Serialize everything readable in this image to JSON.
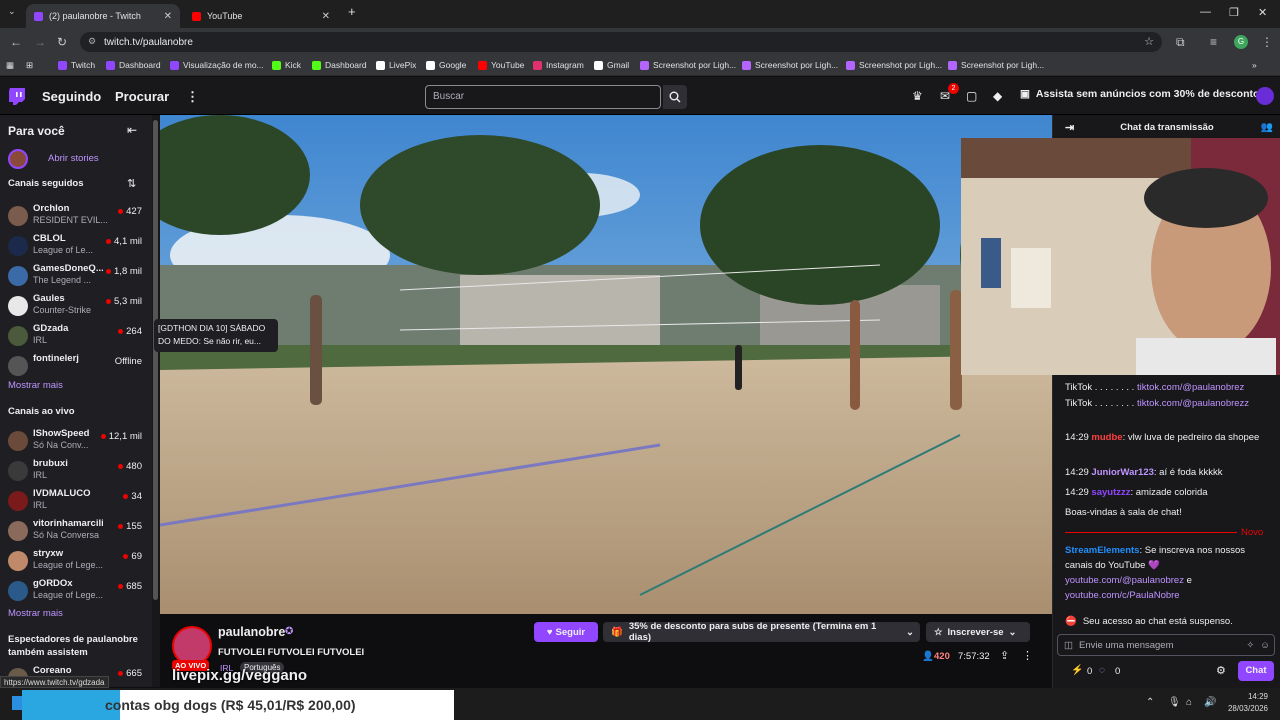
{
  "browser": {
    "tabs": [
      {
        "title": "(2) paulanobre - Twitch",
        "color": "#9146ff"
      },
      {
        "title": "YouTube",
        "color": "#ff0000"
      }
    ],
    "url": "twitch.tv/paulanobre",
    "bookmarks": [
      {
        "label": "Twitch",
        "color": "#9146ff"
      },
      {
        "label": "Dashboard",
        "color": "#9146ff"
      },
      {
        "label": "Visualização de mo...",
        "color": "#9146ff"
      },
      {
        "label": "Kick",
        "color": "#53fc18"
      },
      {
        "label": "Dashboard",
        "color": "#53fc18"
      },
      {
        "label": "LivePix",
        "color": "#ffffff"
      },
      {
        "label": "Google",
        "color": "#ffffff"
      },
      {
        "label": "YouTube",
        "color": "#ff0000"
      },
      {
        "label": "Instagram",
        "color": "#e1306c"
      },
      {
        "label": "Gmail",
        "color": "#ffffff"
      },
      {
        "label": "Screenshot por Ligh...",
        "color": "#b366ff"
      },
      {
        "label": "Screenshot por Ligh...",
        "color": "#b366ff"
      },
      {
        "label": "Screenshot por Ligh...",
        "color": "#b366ff"
      },
      {
        "label": "Screenshot por Ligh...",
        "color": "#b366ff"
      }
    ],
    "status_url": "https://www.twitch.tv/gdzada"
  },
  "twitch": {
    "nav": {
      "following": "Seguindo",
      "browse": "Procurar",
      "search_placeholder": "Buscar",
      "notif_count": "2",
      "promo": "Assista sem anúncios com 30% de desconto"
    },
    "sidebar": {
      "for_you": "Para você",
      "stories": "Abrir stories",
      "followed_title": "Canais seguidos",
      "followed": [
        {
          "name": "Orchlon",
          "game": "RESIDENT EVIL...",
          "viewers": "427",
          "color": "#7a5b4c"
        },
        {
          "name": "CBLOL",
          "game": "League of Le...",
          "viewers": "4,1 mil",
          "color": "#1b2a4a"
        },
        {
          "name": "GamesDoneQ...",
          "game": "The Legend ...",
          "viewers": "1,8 mil",
          "color": "#3a6aa8"
        },
        {
          "name": "Gaules",
          "game": "Counter-Strike",
          "viewers": "5,3 mil",
          "color": "#e8e8e8"
        },
        {
          "name": "GDzada",
          "game": "IRL",
          "viewers": "264",
          "color": "#4a5a3a"
        },
        {
          "name": "fontinelerj",
          "game": "",
          "viewers": "Offline",
          "color": "#555555"
        }
      ],
      "show_more": "Mostrar mais",
      "live_title": "Canais ao vivo",
      "live": [
        {
          "name": "IShowSpeed",
          "game": "Só Na Conv...",
          "viewers": "12,1 mil",
          "color": "#6a4a3a"
        },
        {
          "name": "brubuxi",
          "game": "IRL",
          "viewers": "480",
          "color": "#3a3a3a"
        },
        {
          "name": "IVDMALUCO",
          "game": "IRL",
          "viewers": "34",
          "color": "#7a1a1a"
        },
        {
          "name": "vitorinhamarcilio",
          "game": "Só Na Conversa",
          "viewers": "155",
          "color": "#8a6a5a"
        },
        {
          "name": "stryxw",
          "game": "League of Lege...",
          "viewers": "69",
          "color": "#c08a6a"
        },
        {
          "name": "gORDOx",
          "game": "League of Lege...",
          "viewers": "685",
          "color": "#2a5a8a"
        }
      ],
      "show_more2": "Mostrar mais",
      "viewers_title": "Espectadores de paulanobre também assistem",
      "also": {
        "name": "Coreano",
        "viewers": "665"
      }
    },
    "tooltip": "[GDTHON DIA 10] SÁBADO DO MEDO: Se não rir, eu...",
    "stream": {
      "channel": "paulanobre",
      "title": "FUTVOLEI FUTVOLEI FUTVOLEI",
      "live_badge": "AO VIVO",
      "category": "IRL",
      "language": "Português",
      "follow": "Seguir",
      "gift_promo": "35% de desconto para subs de presente (Termina em 1 dias)",
      "subscribe": "Inscrever-se",
      "viewers": "420",
      "uptime": "7:57:32",
      "overlay_text": "livepix.gg/veggano",
      "donation_text": "contas obg dogs (R$ 45,01/R$ 200,00)"
    },
    "chat": {
      "header": "Chat da transmissão",
      "social": [
        {
          "label": "TikTok . . . . . . . .",
          "link": "tiktok.com/@paulanobrez"
        },
        {
          "label": "TikTok . . . . . . . .",
          "link": "tiktok.com/@paulanobrezz"
        }
      ],
      "messages": [
        {
          "time": "14:29",
          "user": "mudbe",
          "color": "#ff4040",
          "text": ": vlw luva de pedreiro da shopee"
        },
        {
          "time": "14:29",
          "user": "JuniorWar123",
          "color": "#bf94ff",
          "text": ": aí é foda kkkkk"
        },
        {
          "time": "14:29",
          "user": "sayutzzz",
          "color": "#9146ff",
          "text": ": amizade colorida"
        }
      ],
      "welcome": "Boas-vindas à sala de chat!",
      "new_label": "Novo",
      "se_user": "StreamElements",
      "se_text": ": Se inscreva nos nossos canais do YouTube 💜",
      "se_link1": "youtube.com/@paulanobrez",
      "se_and": " e ",
      "se_link2": "youtube.com/c/PaulaNobre",
      "suspended": "Seu acesso ao chat está suspenso.",
      "input_placeholder": "Envie uma mensagem",
      "points": "0",
      "bits": "0",
      "chat_button": "Chat"
    }
  },
  "taskbar": {
    "time": "14:29",
    "date": "28/03/2026"
  }
}
